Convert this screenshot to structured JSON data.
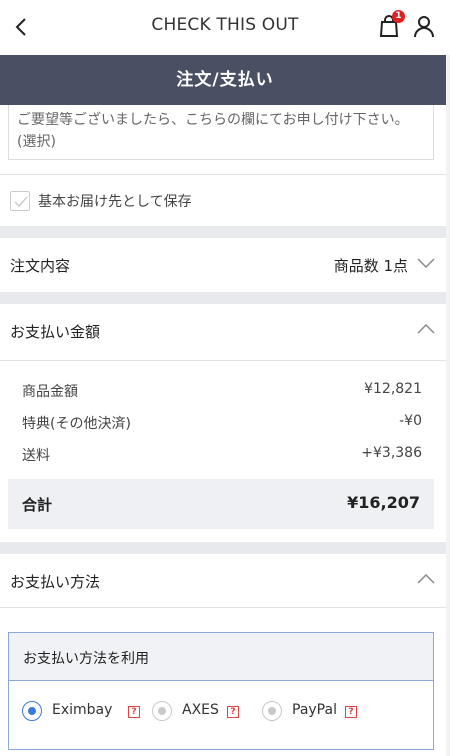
{
  "topbar": {
    "brand": "CHECK THIS OUT",
    "cart_count": "1"
  },
  "header": {
    "title": "注文/支払い"
  },
  "note": {
    "text": "ご要望等ございましたら、こちらの欄にてお申し付け下さい。(選択)"
  },
  "save_address": {
    "label": "基本お届け先として保存",
    "checked": false
  },
  "order_contents": {
    "title": "注文内容",
    "summary": "商品数 1点"
  },
  "payment_amount": {
    "title": "お支払い金額",
    "rows": [
      {
        "label": "商品金額",
        "value": "¥12,821"
      },
      {
        "label": "特典(その他決済)",
        "value": "-¥0"
      },
      {
        "label": "送料",
        "value": "+¥3,386"
      }
    ],
    "total_label": "合計",
    "total_value": "¥16,207"
  },
  "payment_method": {
    "title": "お支払い方法",
    "box_title": "お支払い方法を利用",
    "options": [
      {
        "label": "Eximbay",
        "selected": true,
        "help": "?"
      },
      {
        "label": "AXES",
        "selected": false,
        "help": "?"
      },
      {
        "label": "PayPal",
        "selected": false,
        "help": "?"
      }
    ]
  },
  "colors": {
    "header_bg": "#4a5064",
    "accent": "#3a7bd5",
    "badge": "#e02020"
  }
}
